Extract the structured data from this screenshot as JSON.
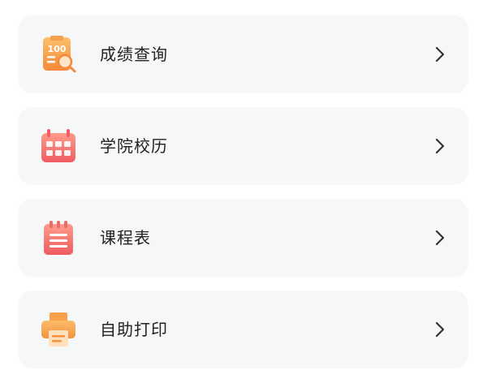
{
  "menu": {
    "items": [
      {
        "label": "成绩查询",
        "icon": "score-report-icon"
      },
      {
        "label": "学院校历",
        "icon": "calendar-icon"
      },
      {
        "label": "课程表",
        "icon": "schedule-list-icon"
      },
      {
        "label": "自助打印",
        "icon": "printer-icon"
      }
    ]
  },
  "score_icon_text": "100",
  "colors": {
    "card_bg": "#f6f7f9",
    "label": "#222222",
    "chevron": "#333333",
    "orange": "#f7a24a",
    "red": "#f26c6c"
  }
}
